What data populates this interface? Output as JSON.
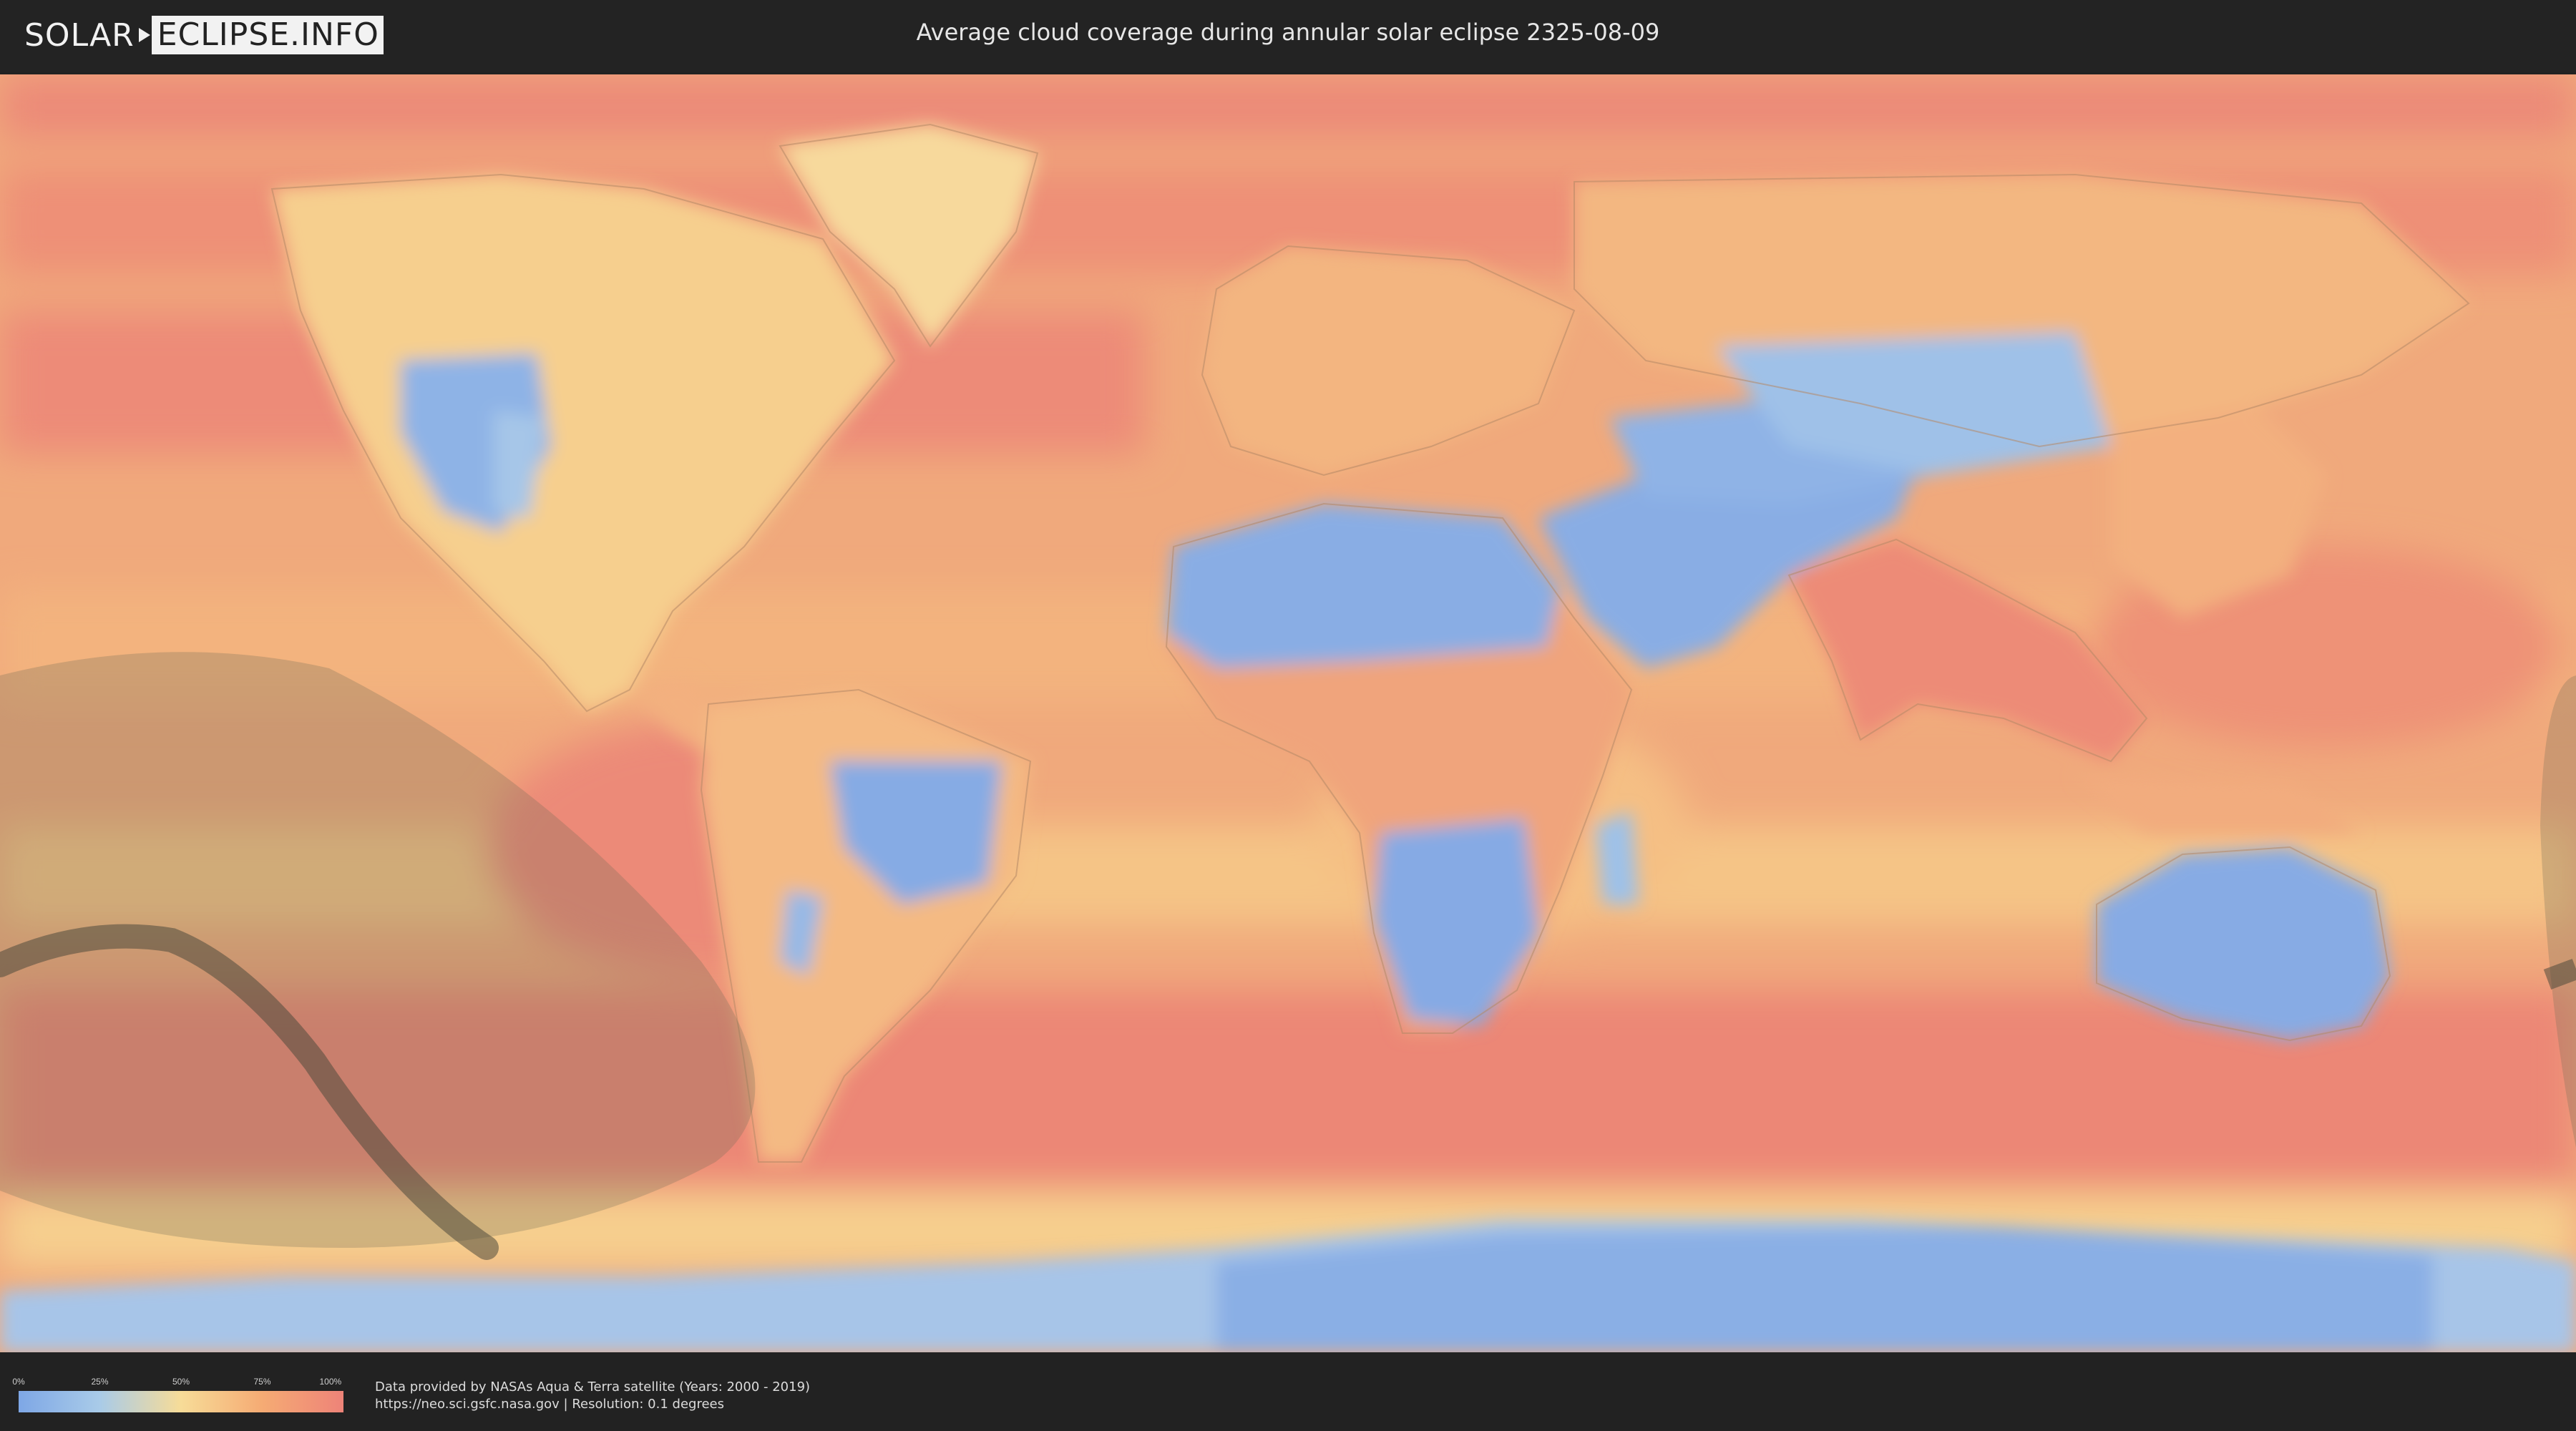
{
  "header": {
    "logo_part1": "SOLAR",
    "logo_part2": "ECLIPSE.INFO",
    "title": "Average cloud coverage during annular solar eclipse 2325-08-09"
  },
  "legend": {
    "ticks": [
      "0%",
      "25%",
      "50%",
      "75%",
      "100%"
    ],
    "colors": [
      "#7ea7e6",
      "#a9cbe8",
      "#f7dc98",
      "#f5ab74",
      "#ee8378"
    ]
  },
  "credits": {
    "line1": "Data provided by NASAs Aqua & Terra satellite (Years: 2000 - 2019)",
    "line2": "https://neo.sci.gsfc.nasa.gov | Resolution: 0.1 degrees"
  },
  "map": {
    "ocean_color": "#f1a47a",
    "cloudy_color": "#ec8876",
    "land_color": "#f6cc8c",
    "clear_color": "#87abe4",
    "eclipse_zone_color": "#6e6a55",
    "eclipse_path_color": "#4f4a3c"
  }
}
